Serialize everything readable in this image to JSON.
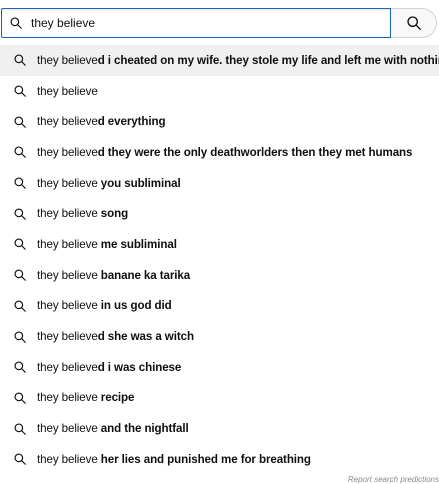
{
  "search": {
    "query": "they believe",
    "icon": "search-icon"
  },
  "search_button": {
    "icon": "search-icon"
  },
  "suggestions": [
    {
      "prefix": "they believe",
      "suffix": "d i cheated on my wife. they stole my life and left me with nothing"
    },
    {
      "prefix": "they believe",
      "suffix": ""
    },
    {
      "prefix": "they believe",
      "suffix": "d everything"
    },
    {
      "prefix": "they believe",
      "suffix": "d they were the only deathworlders then they met humans"
    },
    {
      "prefix": "they believe",
      "suffix": " you subliminal"
    },
    {
      "prefix": "they believe",
      "suffix": " song"
    },
    {
      "prefix": "they believe",
      "suffix": " me subliminal"
    },
    {
      "prefix": "they believe",
      "suffix": " banane ka tarika"
    },
    {
      "prefix": "they believe",
      "suffix": " in us god did"
    },
    {
      "prefix": "they believe",
      "suffix": "d she was a witch"
    },
    {
      "prefix": "they believe",
      "suffix": "d i was chinese"
    },
    {
      "prefix": "they believe",
      "suffix": " recipe"
    },
    {
      "prefix": "they believe",
      "suffix": " and the nightfall"
    },
    {
      "prefix": "they believe",
      "suffix": " her lies and punished me for breathing"
    }
  ],
  "report_link": "Report search predictions",
  "colors": {
    "focus_border": "#1c62b9",
    "highlight_bg": "#f0f0f0",
    "button_bg": "#f8f8f8"
  }
}
